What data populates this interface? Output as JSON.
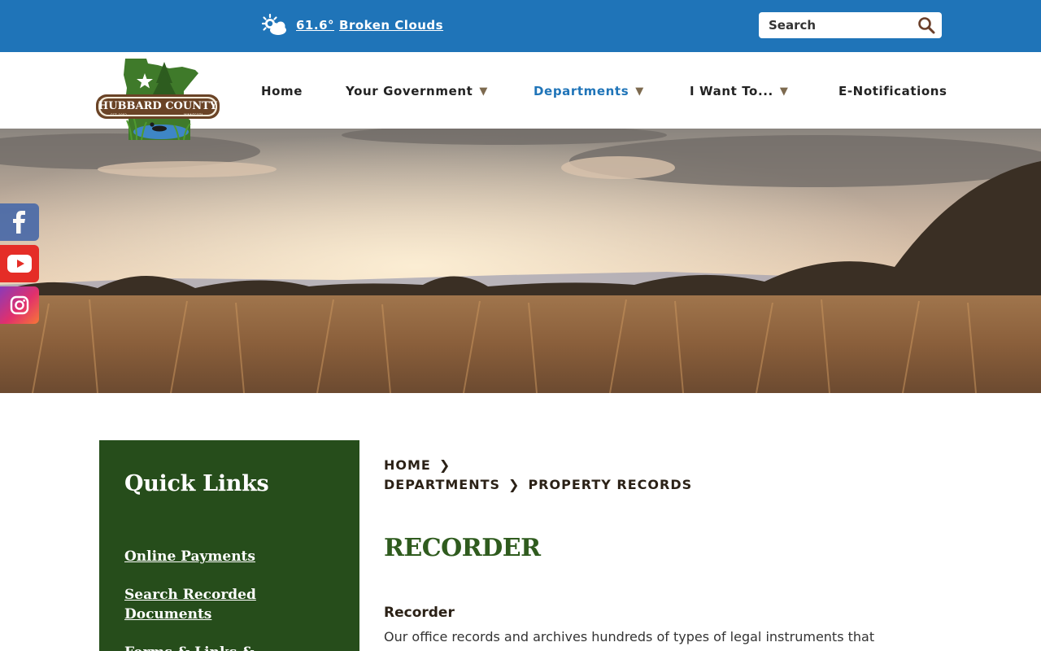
{
  "topbar": {
    "weather_temp": "61.6°",
    "weather_desc": "Broken Clouds",
    "weather_icon": "partly-cloudy-icon",
    "search_placeholder": "Search",
    "search_icon": "search-icon"
  },
  "brand": {
    "logo_text": "HUBBARD COUNTY",
    "logo_est": "EST. 1883",
    "logo_state": "MINNESOTA"
  },
  "nav": {
    "items": [
      {
        "label": "Home",
        "has_dropdown": false
      },
      {
        "label": "Your Government",
        "has_dropdown": true
      },
      {
        "label": "Departments",
        "has_dropdown": true,
        "active": true
      },
      {
        "label": "I Want To...",
        "has_dropdown": true
      },
      {
        "label": "E-Notifications",
        "has_dropdown": false
      }
    ],
    "caret": "▼"
  },
  "social": [
    "facebook-icon",
    "youtube-icon",
    "instagram-icon"
  ],
  "sidebar": {
    "title": "Quick Links",
    "links": [
      "Online Payments",
      "Search Recorded Documents",
      "Forms & Links & Documents"
    ]
  },
  "breadcrumb": {
    "items": [
      "HOME",
      "DEPARTMENTS",
      "PROPERTY RECORDS"
    ]
  },
  "main": {
    "title": "RECORDER",
    "section_heading": "Recorder",
    "intro": "Our office records and archives hundreds of types of legal instruments that"
  },
  "colors": {
    "topbar": "#1f74b8",
    "sidebar": "#264d1b",
    "title_green": "#2f5b1e",
    "active_nav": "#1f74b8"
  }
}
